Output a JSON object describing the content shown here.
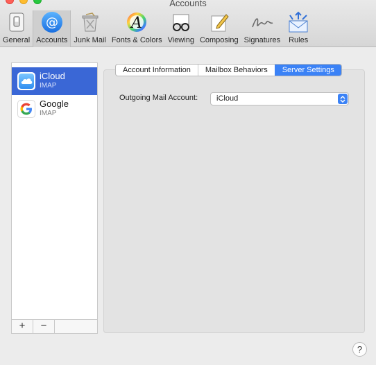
{
  "window": {
    "title": "Accounts"
  },
  "toolbar": {
    "items": [
      {
        "label": "General",
        "icon": "general-switch-icon",
        "active": false
      },
      {
        "label": "Accounts",
        "icon": "at-sign-icon",
        "active": true
      },
      {
        "label": "Junk Mail",
        "icon": "trash-bin-icon",
        "active": false
      },
      {
        "label": "Fonts & Colors",
        "icon": "color-wheel-font-icon",
        "active": false
      },
      {
        "label": "Viewing",
        "icon": "glasses-icon",
        "active": false
      },
      {
        "label": "Composing",
        "icon": "pencil-note-icon",
        "active": false
      },
      {
        "label": "Signatures",
        "icon": "signature-icon",
        "active": false
      },
      {
        "label": "Rules",
        "icon": "envelope-arrows-icon",
        "active": false
      }
    ]
  },
  "accounts": [
    {
      "name": "iCloud",
      "type": "IMAP",
      "icon": "icloud-icon",
      "selected": true
    },
    {
      "name": "Google",
      "type": "IMAP",
      "icon": "google-icon",
      "selected": false
    }
  ],
  "list_footer": {
    "add": "+",
    "remove": "−"
  },
  "tabs": [
    {
      "label": "Account Information",
      "active": false
    },
    {
      "label": "Mailbox Behaviors",
      "active": false
    },
    {
      "label": "Server Settings",
      "active": true
    }
  ],
  "server_settings": {
    "outgoing_label": "Outgoing Mail Account:",
    "outgoing_value": "iCloud"
  },
  "help": {
    "label": "?"
  },
  "colors": {
    "selection": "#3a67d6",
    "accent": "#3b82f6"
  }
}
